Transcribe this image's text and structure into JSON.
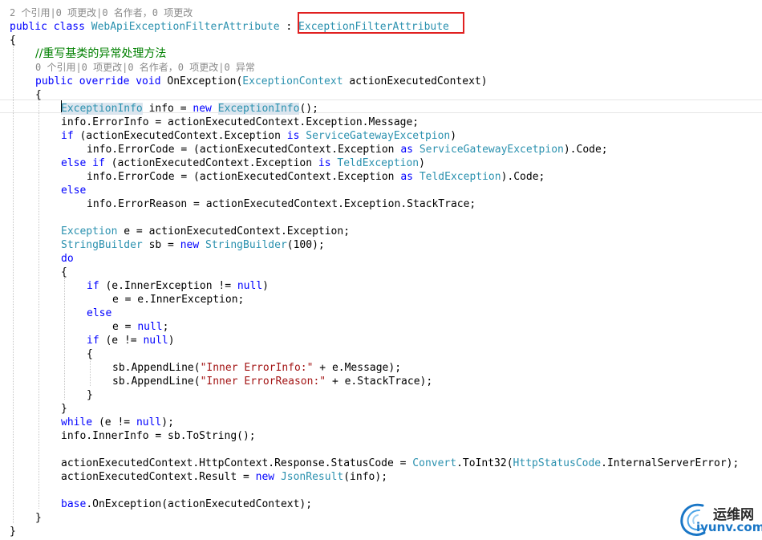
{
  "editor": {
    "lines": [
      {
        "indent": 0,
        "lens": true,
        "tokens": [
          {
            "t": "2 个引用|0 项更改|0 名作者，0 项更改",
            "c": "lens"
          }
        ]
      },
      {
        "indent": 0,
        "tokens": [
          {
            "t": "public class ",
            "c": "kw"
          },
          {
            "t": "WebApiExceptionFilterAttribute",
            "c": "type"
          },
          {
            "t": " : ",
            "c": "plain"
          },
          {
            "t": "ExceptionFilterAttribute",
            "c": "type"
          }
        ]
      },
      {
        "indent": 0,
        "tokens": [
          {
            "t": "{",
            "c": "plain"
          }
        ]
      },
      {
        "indent": 1,
        "tokens": [
          {
            "t": "//重写基类的异常处理方法",
            "c": "cm"
          }
        ]
      },
      {
        "indent": 1,
        "lens": true,
        "tokens": [
          {
            "t": "0 个引用|0 项更改|0 名作者，0 项更改|0 异常",
            "c": "lens"
          }
        ]
      },
      {
        "indent": 1,
        "tokens": [
          {
            "t": "public override void ",
            "c": "kw"
          },
          {
            "t": "OnException(",
            "c": "plain"
          },
          {
            "t": "ExceptionContext",
            "c": "type"
          },
          {
            "t": " actionExecutedContext)",
            "c": "plain"
          }
        ]
      },
      {
        "indent": 1,
        "tokens": [
          {
            "t": "{",
            "c": "plain"
          }
        ]
      },
      {
        "indent": 2,
        "tokens": [
          {
            "t": "ExceptionInfo",
            "c": "type-sel"
          },
          {
            "t": " info = ",
            "c": "plain"
          },
          {
            "t": "new ",
            "c": "kw"
          },
          {
            "t": "ExceptionInfo",
            "c": "type-sel"
          },
          {
            "t": "();",
            "c": "plain"
          }
        ]
      },
      {
        "indent": 2,
        "tokens": [
          {
            "t": "info.ErrorInfo = actionExecutedContext.Exception.Message;",
            "c": "plain"
          }
        ]
      },
      {
        "indent": 2,
        "tokens": [
          {
            "t": "if",
            "c": "kw"
          },
          {
            "t": " (actionExecutedContext.Exception ",
            "c": "plain"
          },
          {
            "t": "is",
            "c": "kw"
          },
          {
            "t": " ",
            "c": "plain"
          },
          {
            "t": "ServiceGatewayExcetpion",
            "c": "type"
          },
          {
            "t": ")",
            "c": "plain"
          }
        ]
      },
      {
        "indent": 3,
        "tokens": [
          {
            "t": "info.ErrorCode = (actionExecutedContext.Exception ",
            "c": "plain"
          },
          {
            "t": "as",
            "c": "kw"
          },
          {
            "t": " ",
            "c": "plain"
          },
          {
            "t": "ServiceGatewayExcetpion",
            "c": "type"
          },
          {
            "t": ").Code;",
            "c": "plain"
          }
        ]
      },
      {
        "indent": 2,
        "tokens": [
          {
            "t": "else if",
            "c": "kw"
          },
          {
            "t": " (actionExecutedContext.Exception ",
            "c": "plain"
          },
          {
            "t": "is",
            "c": "kw"
          },
          {
            "t": " ",
            "c": "plain"
          },
          {
            "t": "TeldException",
            "c": "type"
          },
          {
            "t": ")",
            "c": "plain"
          }
        ]
      },
      {
        "indent": 3,
        "tokens": [
          {
            "t": "info.ErrorCode = (actionExecutedContext.Exception ",
            "c": "plain"
          },
          {
            "t": "as",
            "c": "kw"
          },
          {
            "t": " ",
            "c": "plain"
          },
          {
            "t": "TeldException",
            "c": "type"
          },
          {
            "t": ").Code;",
            "c": "plain"
          }
        ]
      },
      {
        "indent": 2,
        "tokens": [
          {
            "t": "else",
            "c": "kw"
          }
        ]
      },
      {
        "indent": 3,
        "tokens": [
          {
            "t": "info.ErrorReason = actionExecutedContext.Exception.StackTrace;",
            "c": "plain"
          }
        ]
      },
      {
        "indent": 2,
        "tokens": []
      },
      {
        "indent": 2,
        "tokens": [
          {
            "t": "Exception",
            "c": "type"
          },
          {
            "t": " e = actionExecutedContext.Exception;",
            "c": "plain"
          }
        ]
      },
      {
        "indent": 2,
        "tokens": [
          {
            "t": "StringBuilder",
            "c": "type"
          },
          {
            "t": " sb = ",
            "c": "plain"
          },
          {
            "t": "new ",
            "c": "kw"
          },
          {
            "t": "StringBuilder",
            "c": "type"
          },
          {
            "t": "(100);",
            "c": "plain"
          }
        ]
      },
      {
        "indent": 2,
        "tokens": [
          {
            "t": "do",
            "c": "kw"
          }
        ]
      },
      {
        "indent": 2,
        "tokens": [
          {
            "t": "{",
            "c": "plain"
          }
        ]
      },
      {
        "indent": 3,
        "tokens": [
          {
            "t": "if",
            "c": "kw"
          },
          {
            "t": " (e.InnerException != ",
            "c": "plain"
          },
          {
            "t": "null",
            "c": "kw"
          },
          {
            "t": ")",
            "c": "plain"
          }
        ]
      },
      {
        "indent": 4,
        "tokens": [
          {
            "t": "e = e.InnerException;",
            "c": "plain"
          }
        ]
      },
      {
        "indent": 3,
        "tokens": [
          {
            "t": "else",
            "c": "kw"
          }
        ]
      },
      {
        "indent": 4,
        "tokens": [
          {
            "t": "e = ",
            "c": "plain"
          },
          {
            "t": "null",
            "c": "kw"
          },
          {
            "t": ";",
            "c": "plain"
          }
        ]
      },
      {
        "indent": 3,
        "tokens": [
          {
            "t": "if",
            "c": "kw"
          },
          {
            "t": " (e != ",
            "c": "plain"
          },
          {
            "t": "null",
            "c": "kw"
          },
          {
            "t": ")",
            "c": "plain"
          }
        ]
      },
      {
        "indent": 3,
        "tokens": [
          {
            "t": "{",
            "c": "plain"
          }
        ]
      },
      {
        "indent": 4,
        "tokens": [
          {
            "t": "sb.AppendLine(",
            "c": "plain"
          },
          {
            "t": "\"Inner ErrorInfo:\"",
            "c": "str"
          },
          {
            "t": " + e.Message);",
            "c": "plain"
          }
        ]
      },
      {
        "indent": 4,
        "tokens": [
          {
            "t": "sb.AppendLine(",
            "c": "plain"
          },
          {
            "t": "\"Inner ErrorReason:\"",
            "c": "str"
          },
          {
            "t": " + e.StackTrace);",
            "c": "plain"
          }
        ]
      },
      {
        "indent": 3,
        "tokens": [
          {
            "t": "}",
            "c": "plain"
          }
        ]
      },
      {
        "indent": 2,
        "tokens": [
          {
            "t": "}",
            "c": "plain"
          }
        ]
      },
      {
        "indent": 2,
        "tokens": [
          {
            "t": "while",
            "c": "kw"
          },
          {
            "t": " (e != ",
            "c": "plain"
          },
          {
            "t": "null",
            "c": "kw"
          },
          {
            "t": ");",
            "c": "plain"
          }
        ]
      },
      {
        "indent": 2,
        "tokens": [
          {
            "t": "info.InnerInfo = sb.ToString();",
            "c": "plain"
          }
        ]
      },
      {
        "indent": 2,
        "tokens": []
      },
      {
        "indent": 2,
        "tokens": [
          {
            "t": "actionExecutedContext.HttpContext.Response.StatusCode = ",
            "c": "plain"
          },
          {
            "t": "Convert",
            "c": "type"
          },
          {
            "t": ".ToInt32(",
            "c": "plain"
          },
          {
            "t": "HttpStatusCode",
            "c": "type"
          },
          {
            "t": ".InternalServerError);",
            "c": "plain"
          }
        ]
      },
      {
        "indent": 2,
        "tokens": [
          {
            "t": "actionExecutedContext.Result = ",
            "c": "plain"
          },
          {
            "t": "new ",
            "c": "kw"
          },
          {
            "t": "JsonResult",
            "c": "type"
          },
          {
            "t": "(info);",
            "c": "plain"
          }
        ]
      },
      {
        "indent": 2,
        "tokens": []
      },
      {
        "indent": 2,
        "tokens": [
          {
            "t": "base",
            "c": "kw"
          },
          {
            "t": ".OnException(actionExecutedContext);",
            "c": "plain"
          }
        ]
      },
      {
        "indent": 1,
        "tokens": [
          {
            "t": "}",
            "c": "plain"
          }
        ]
      },
      {
        "indent": 0,
        "tokens": [
          {
            "t": "}",
            "c": "plain"
          }
        ]
      }
    ]
  },
  "watermark": {
    "cn": "运维网",
    "url": "iyunv.com"
  },
  "colors": {
    "keyword": "#0000ff",
    "type": "#2b91af",
    "string": "#a31515",
    "comment": "#008000",
    "codelens": "#8a8a8a",
    "highlight_border": "#e02020",
    "selection": "#dbe5ee",
    "watermark_url": "#1976c6"
  }
}
